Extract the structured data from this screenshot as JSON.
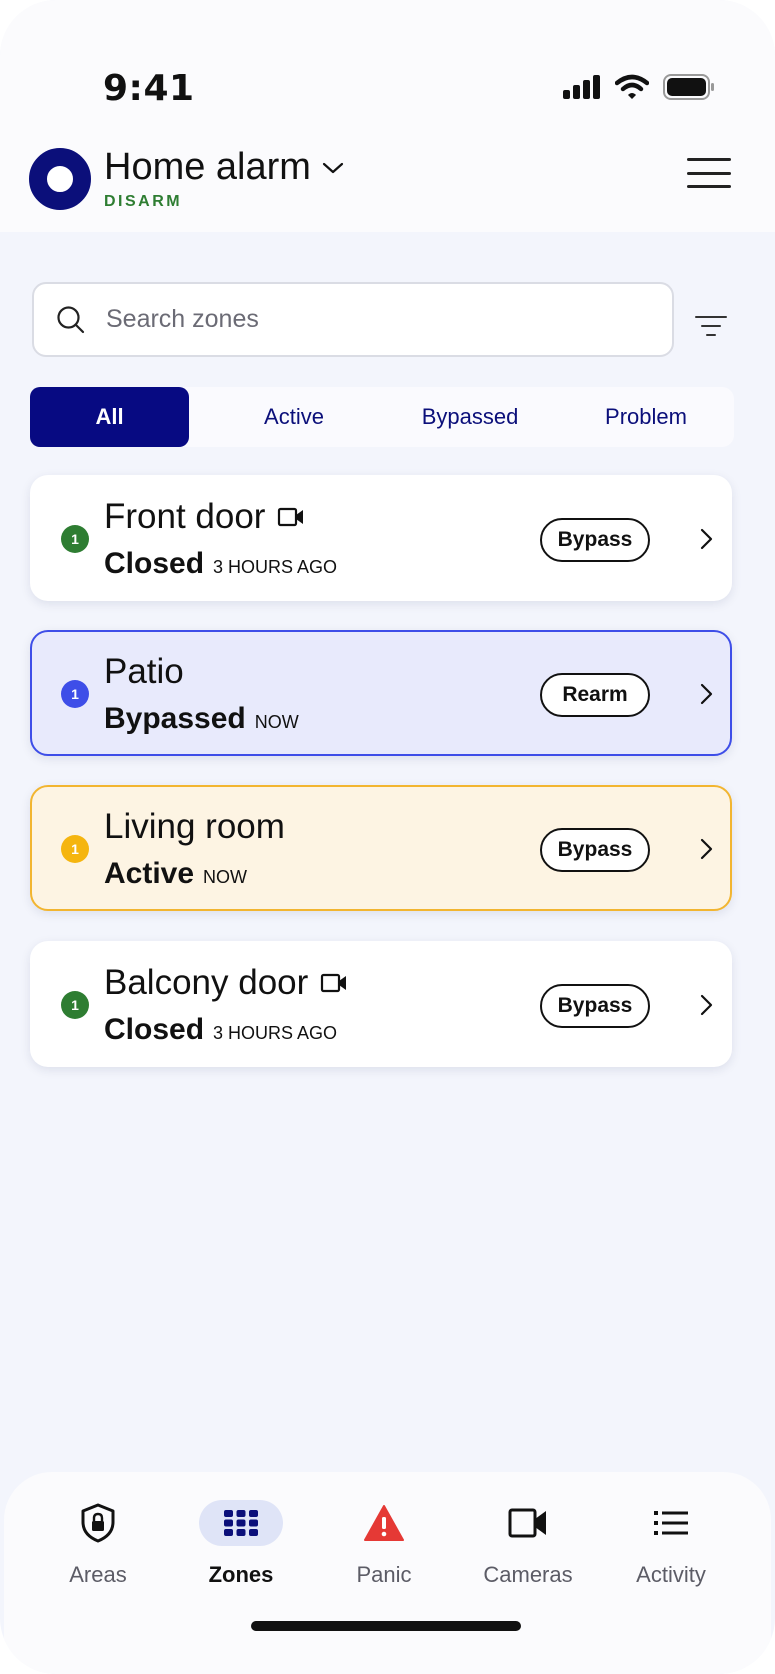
{
  "status_bar": {
    "time": "9:41"
  },
  "header": {
    "title": "Home alarm",
    "status": "DISARM",
    "status_color": "#2e7d32",
    "brand_color": "#0b0f7a"
  },
  "search": {
    "placeholder": "Search zones"
  },
  "tabs": [
    {
      "label": "All",
      "selected": true
    },
    {
      "label": "Active",
      "selected": false
    },
    {
      "label": "Bypassed",
      "selected": false
    },
    {
      "label": "Problem",
      "selected": false
    }
  ],
  "zones": [
    {
      "badge": "1",
      "name": "Front door",
      "camera": true,
      "state": "Closed",
      "time": "3 HOURS AGO",
      "action": "Bypass",
      "badge_color": "#2e7d32"
    },
    {
      "badge": "1",
      "name": "Patio",
      "camera": false,
      "state": "Bypassed",
      "time": "NOW",
      "action": "Rearm",
      "badge_color": "#3e4ee8"
    },
    {
      "badge": "1",
      "name": "Living room",
      "camera": false,
      "state": "Active",
      "time": "NOW",
      "action": "Bypass",
      "badge_color": "#f5b50f"
    },
    {
      "badge": "1",
      "name": "Balcony door",
      "camera": true,
      "state": "Closed",
      "time": "3 HOURS AGO",
      "action": "Bypass",
      "badge_color": "#2e7d32"
    }
  ],
  "nav": [
    {
      "label": "Areas",
      "icon": "shield-lock-icon",
      "selected": false
    },
    {
      "label": "Zones",
      "icon": "grid-icon",
      "selected": true
    },
    {
      "label": "Panic",
      "icon": "warning-icon",
      "selected": false
    },
    {
      "label": "Cameras",
      "icon": "video-camera-icon",
      "selected": false
    },
    {
      "label": "Activity",
      "icon": "list-icon",
      "selected": false
    }
  ]
}
